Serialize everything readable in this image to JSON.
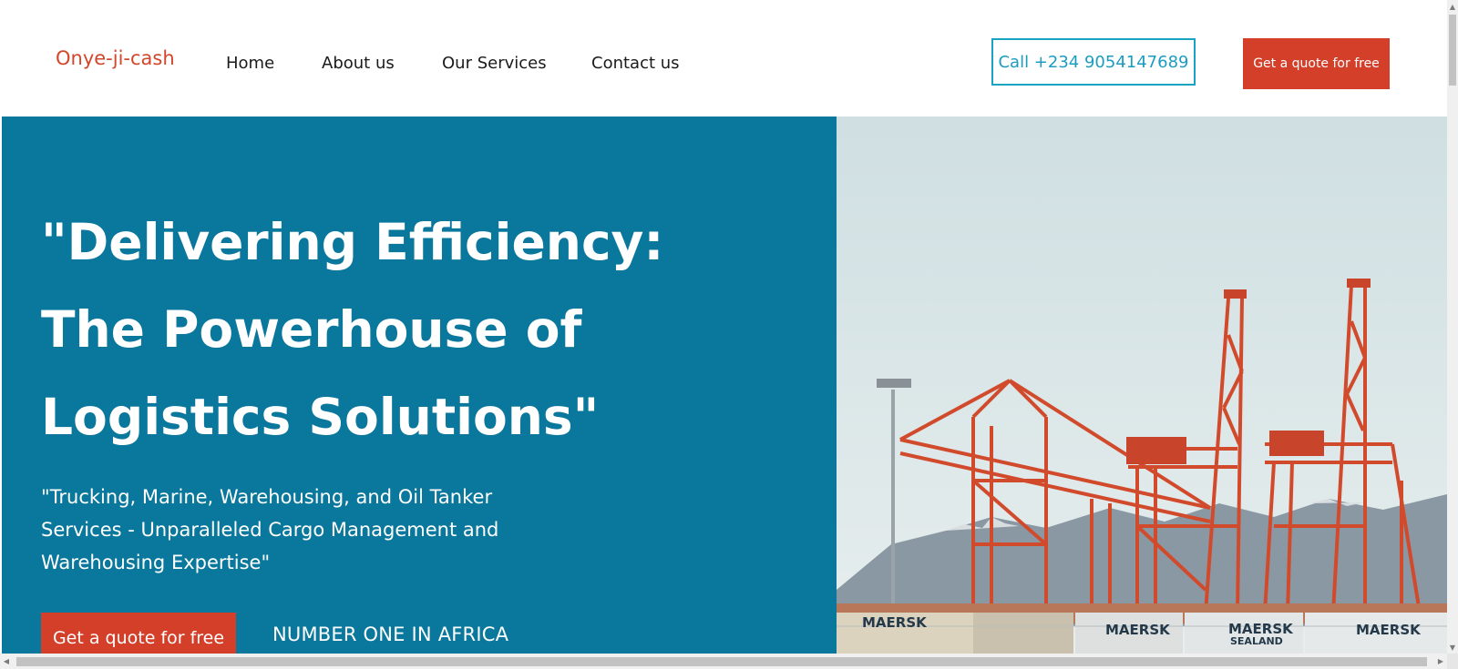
{
  "header": {
    "logo": "Onye-ji-cash",
    "nav": [
      {
        "label": "Home"
      },
      {
        "label": "About us"
      },
      {
        "label": "Our Services"
      },
      {
        "label": "Contact us"
      }
    ],
    "call_label": "Call +234 9054147689",
    "quote_label": "Get a quote for free"
  },
  "hero": {
    "title_lines": [
      "\"Delivering Efficiency:",
      "The Powerhouse of",
      "Logistics Solutions\""
    ],
    "subtitle": "\"Trucking, Marine, Warehousing, and Oil Tanker Services - Unparalleled Cargo Management and Warehousing Expertise\"",
    "cta_label": "Get a quote for free",
    "tagline": "NUMBER ONE IN AFRICA"
  },
  "photo": {
    "container_labels": [
      "MAERSK",
      "MAERSK",
      "MAERSK",
      "SEALAND",
      "MAERSK"
    ]
  },
  "colors": {
    "brand_red": "#d43f2a",
    "hero_blue": "#0a779c",
    "call_border": "#1ba3c6"
  }
}
